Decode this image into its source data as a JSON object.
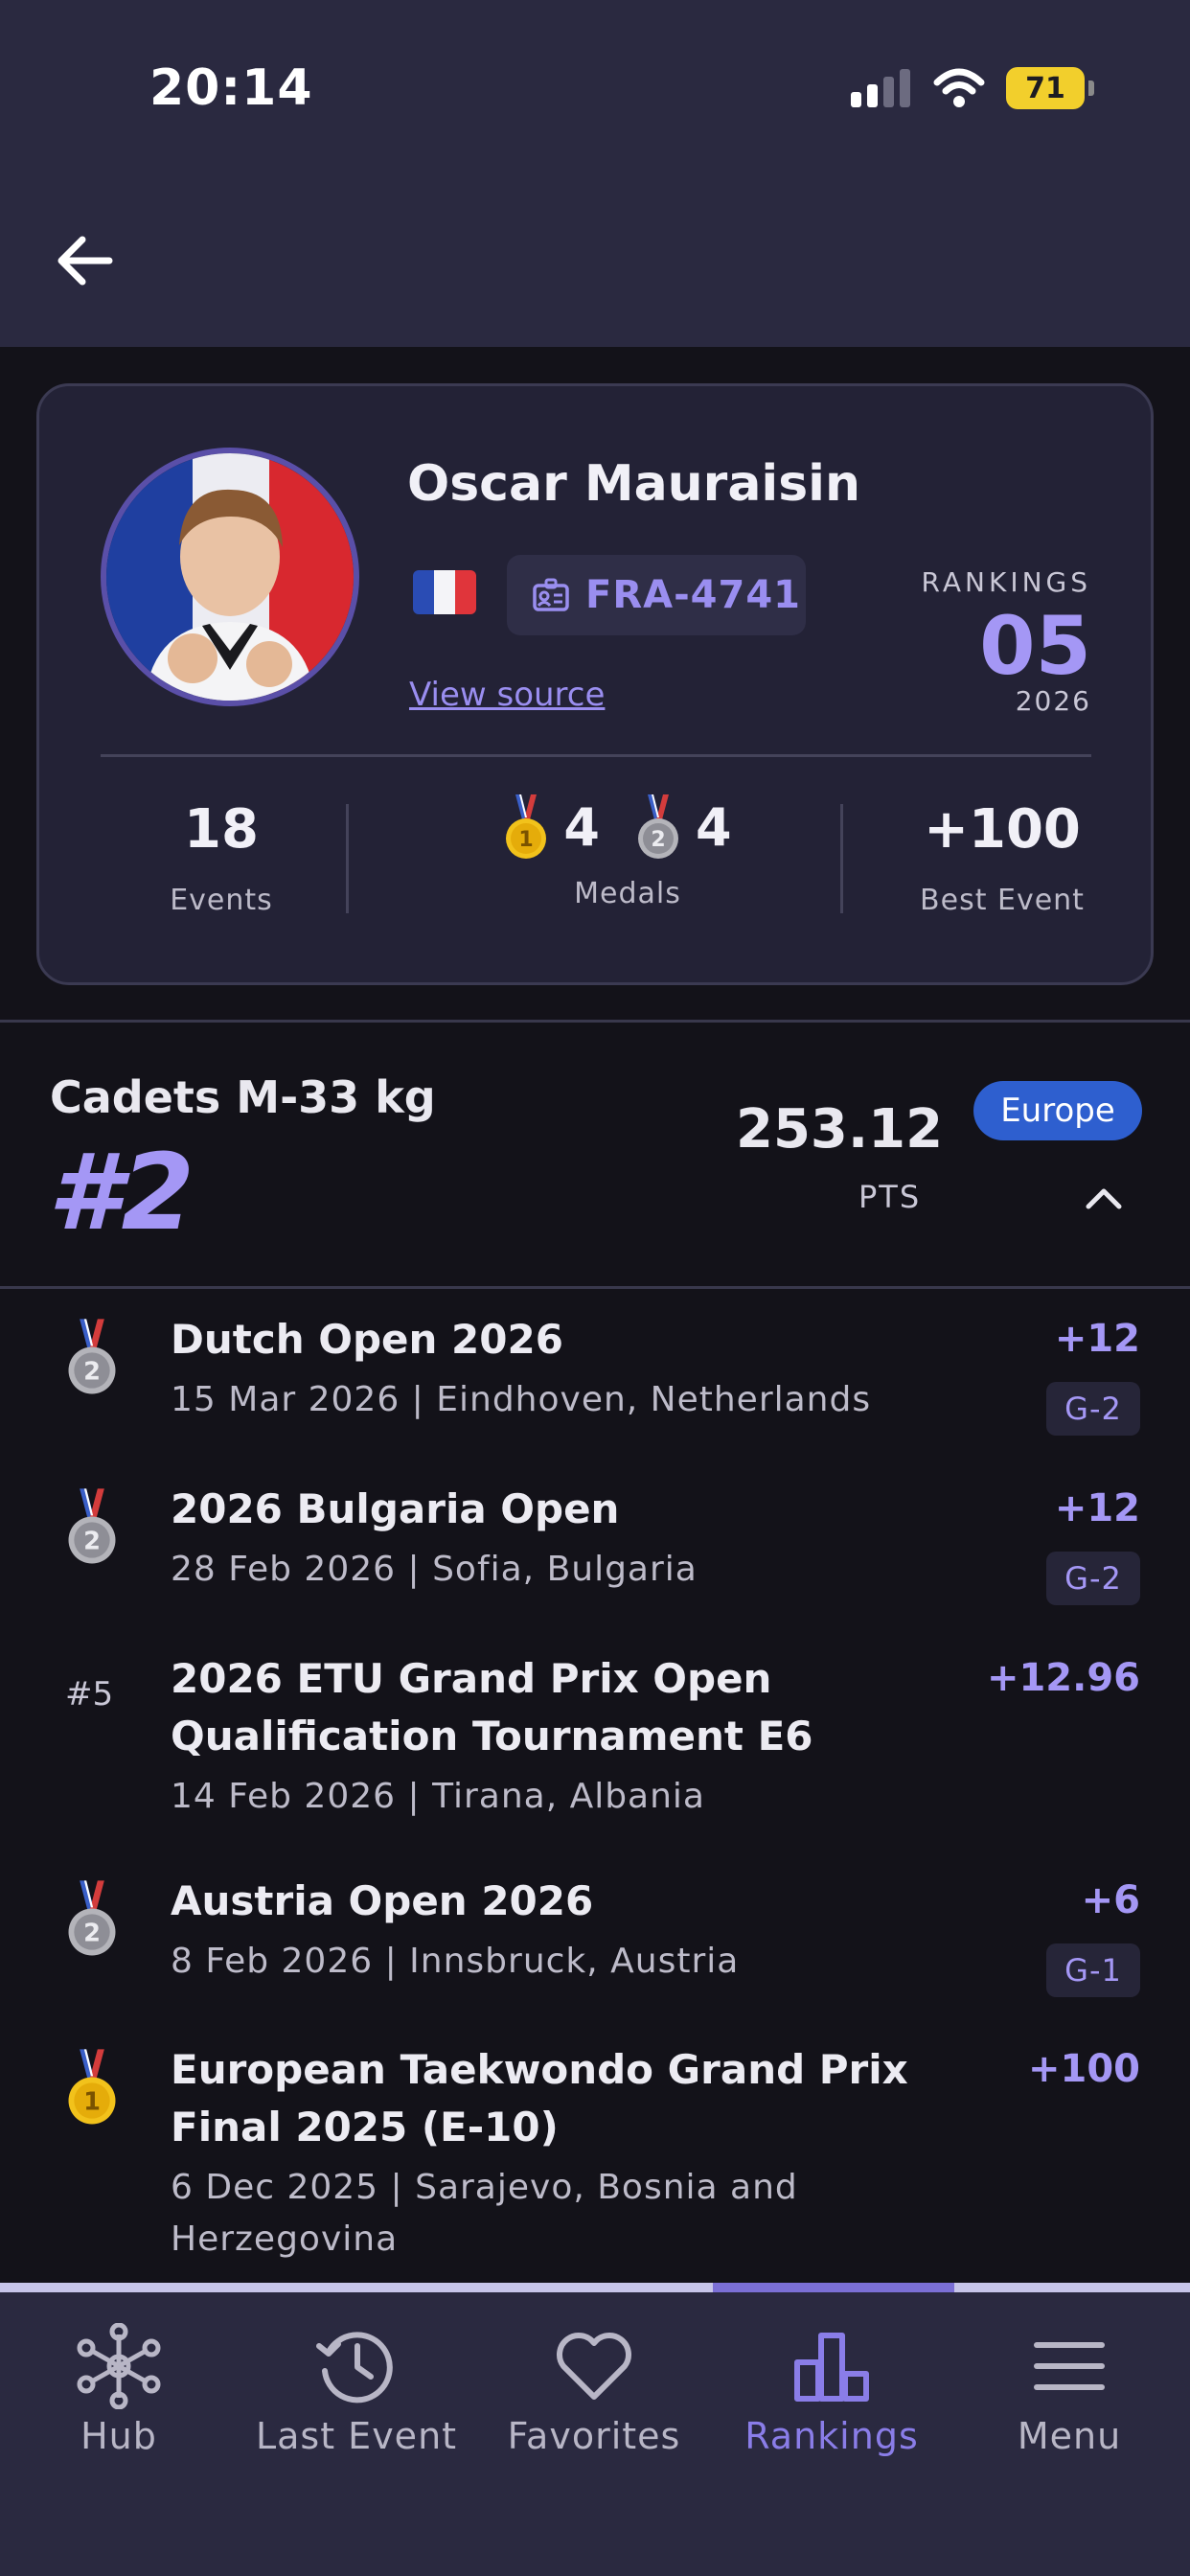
{
  "status_bar": {
    "time": "20:14",
    "battery": "71"
  },
  "header": {
    "back_icon": "arrow-left-icon"
  },
  "profile": {
    "name": "Oscar Mauraisin",
    "country_flag": "France",
    "id_code": "FRA-4741",
    "view_source": "View source",
    "rankings_label": "RANKINGS",
    "rankings_value": "05",
    "rankings_year": "2026",
    "stats": {
      "events_value": "18",
      "events_label": "Events",
      "gold_count": "4",
      "silver_count": "4",
      "medals_label": "Medals",
      "best_event_value": "+100",
      "best_event_label": "Best Event"
    }
  },
  "ranking_section": {
    "division": "Cadets M-33 kg",
    "rank": "#2",
    "points": "253.12",
    "points_label": "PTS",
    "region": "Europe"
  },
  "events": [
    {
      "medal": "silver",
      "place": "",
      "title": "Dutch Open 2026",
      "meta": "15 Mar 2026  |  Eindhoven, Netherlands",
      "points": "+12",
      "grade": "G-2"
    },
    {
      "medal": "silver",
      "place": "",
      "title": "2026 Bulgaria Open",
      "meta": "28 Feb 2026  |  Sofia, Bulgaria",
      "points": "+12",
      "grade": "G-2"
    },
    {
      "medal": "",
      "place": "#5",
      "title": "2026 ETU Grand Prix Open Qualification Tournament E6",
      "meta": "14 Feb 2026  |  Tirana, Albania",
      "points": "+12.96",
      "grade": ""
    },
    {
      "medal": "silver",
      "place": "",
      "title": "Austria Open 2026",
      "meta": "8 Feb 2026  |  Innsbruck, Austria",
      "points": "+6",
      "grade": "G-1"
    },
    {
      "medal": "gold",
      "place": "",
      "title": "European Taekwondo Grand Prix Final 2025 (E-10)",
      "meta": "6 Dec 2025  |  Sarajevo, Bosnia and Herzegovina",
      "points": "+100",
      "grade": ""
    }
  ],
  "bottom_nav": {
    "items": [
      {
        "label": "Hub",
        "icon": "network-icon"
      },
      {
        "label": "Last Event",
        "icon": "history-icon"
      },
      {
        "label": "Favorites",
        "icon": "heart-icon"
      },
      {
        "label": "Rankings",
        "icon": "bar-chart-icon",
        "active": true
      },
      {
        "label": "Menu",
        "icon": "menu-icon"
      }
    ]
  },
  "colors": {
    "accent": "#a497f5",
    "region_badge": "#2e5fcf",
    "gold": "#f2c21b",
    "silver": "#9a9aa0"
  }
}
